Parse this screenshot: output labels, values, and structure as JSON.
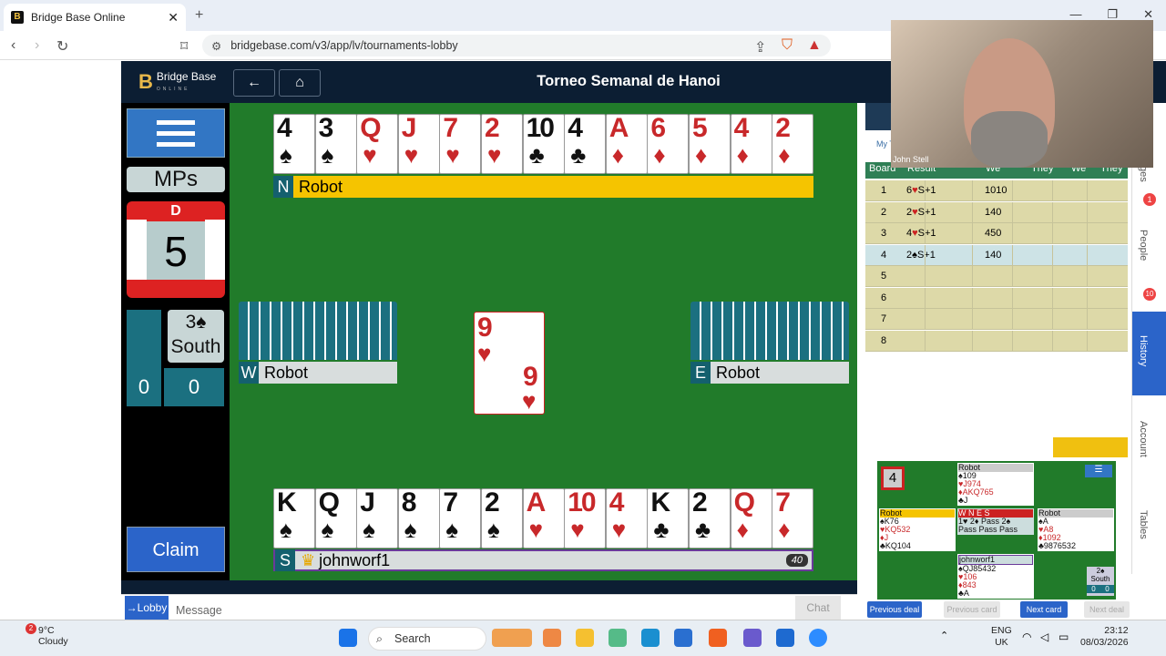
{
  "browser": {
    "tab_title": "Bridge Base Online",
    "url": "bridgebase.com/v3/app/lv/tournaments-lobby"
  },
  "app": {
    "logo": "Bridge Base",
    "logo_sub": "ONLINE",
    "title": "Torneo Semanal de Hanoi"
  },
  "left": {
    "mps": "MPs",
    "dealer": "D",
    "board_number": "5",
    "contract": "3♠",
    "declarer": "South",
    "score_ns": "0",
    "score_ew": "0",
    "claim": "Claim"
  },
  "north": {
    "dir": "N",
    "name": "Robot",
    "cards": [
      [
        "4",
        "♠",
        "blk"
      ],
      [
        "3",
        "♠",
        "blk"
      ],
      [
        "Q",
        "♥",
        "red"
      ],
      [
        "J",
        "♥",
        "red"
      ],
      [
        "7",
        "♥",
        "red"
      ],
      [
        "2",
        "♥",
        "red"
      ],
      [
        "10",
        "♣",
        "blk"
      ],
      [
        "4",
        "♣",
        "blk"
      ],
      [
        "A",
        "♦",
        "red"
      ],
      [
        "6",
        "♦",
        "red"
      ],
      [
        "5",
        "♦",
        "red"
      ],
      [
        "4",
        "♦",
        "red"
      ],
      [
        "2",
        "♦",
        "red"
      ]
    ]
  },
  "west": {
    "dir": "W",
    "name": "Robot"
  },
  "east": {
    "dir": "E",
    "name": "Robot"
  },
  "south": {
    "dir": "S",
    "name": "johnworf1",
    "badge": "40",
    "cards": [
      [
        "K",
        "♠",
        "blk"
      ],
      [
        "Q",
        "♠",
        "blk"
      ],
      [
        "J",
        "♠",
        "blk"
      ],
      [
        "8",
        "♠",
        "blk"
      ],
      [
        "7",
        "♠",
        "blk"
      ],
      [
        "2",
        "♠",
        "blk"
      ],
      [
        "A",
        "♥",
        "red"
      ],
      [
        "10",
        "♥",
        "red"
      ],
      [
        "4",
        "♥",
        "red"
      ],
      [
        "K",
        "♣",
        "blk"
      ],
      [
        "2",
        "♣",
        "blk"
      ],
      [
        "Q",
        "♦",
        "red"
      ],
      [
        "7",
        "♦",
        "red"
      ]
    ]
  },
  "played_card": {
    "rank": "9",
    "suit": "♥"
  },
  "chat": {
    "lobby": "→Lobby",
    "placeholder": "Message",
    "send": "Chat"
  },
  "history": {
    "tab": "My T",
    "headers": [
      "Board",
      "Result",
      "We",
      "They",
      "We",
      "They"
    ],
    "rows": [
      [
        "1",
        "6♥S+1",
        "1010"
      ],
      [
        "2",
        "2♥S+1",
        "140"
      ],
      [
        "3",
        "4♥S+1",
        "450"
      ],
      [
        "4",
        "2♠S+1",
        "140"
      ],
      [
        "5",
        "",
        ""
      ],
      [
        "6",
        "",
        ""
      ],
      [
        "7",
        "",
        ""
      ],
      [
        "8",
        "",
        ""
      ]
    ]
  },
  "mini": {
    "board": "4",
    "north_name": "Robot",
    "north": [
      "♠109",
      "♥J974",
      "♦AKQ765",
      "♣J"
    ],
    "west_name": "Robot",
    "west": [
      "♠K76",
      "♥KQ532",
      "♦J",
      "♣KQ104"
    ],
    "east_name": "Robot",
    "east": [
      "♠A",
      "♥A8",
      "♦1092",
      "♣9876532"
    ],
    "south_name": "johnworf1",
    "south": [
      "♠QJ85432",
      "♥106",
      "♦843",
      "♣A"
    ],
    "auction_head": "W  N  E  S",
    "auction1": "1♥  2♦  Pass  2♠",
    "auction2": "Pass Pass Pass",
    "contract": "2♠ South",
    "score": [
      "0",
      "0"
    ]
  },
  "minibtns": {
    "prev_deal": "Previous deal",
    "prev_card": "Previous card",
    "next_card": "Next card",
    "next_deal": "Next deal"
  },
  "side": {
    "messages": "ges",
    "people": "People",
    "history": "History",
    "account": "Account",
    "tables": "Tables",
    "badge1": "1",
    "badge2": "10"
  },
  "video": {
    "name": "John Stell"
  },
  "taskbar": {
    "temp": "9°C",
    "weather": "Cloudy",
    "weather_badge": "2",
    "search": "Search",
    "lang1": "ENG",
    "lang2": "UK",
    "time": "23:12",
    "date": "08/03/2026"
  }
}
